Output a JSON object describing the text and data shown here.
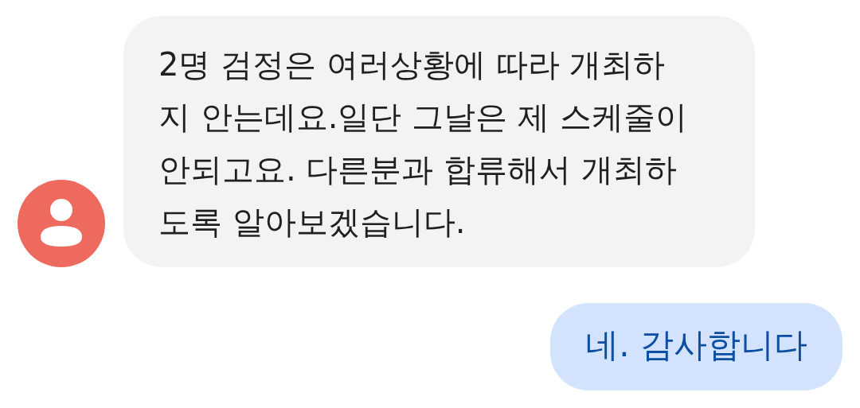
{
  "messages": [
    {
      "kind": "incoming",
      "text": "2명 검정은 여러상황에 따라 개최하지 안는데요.일단 그날은 제 스케줄이 안되고요. 다른분과 합류해서 개최하도록 알아보겠습니다.",
      "color": "#ee6a5e"
    },
    {
      "kind": "outgoing",
      "text": "네. 감사합니다"
    }
  ]
}
